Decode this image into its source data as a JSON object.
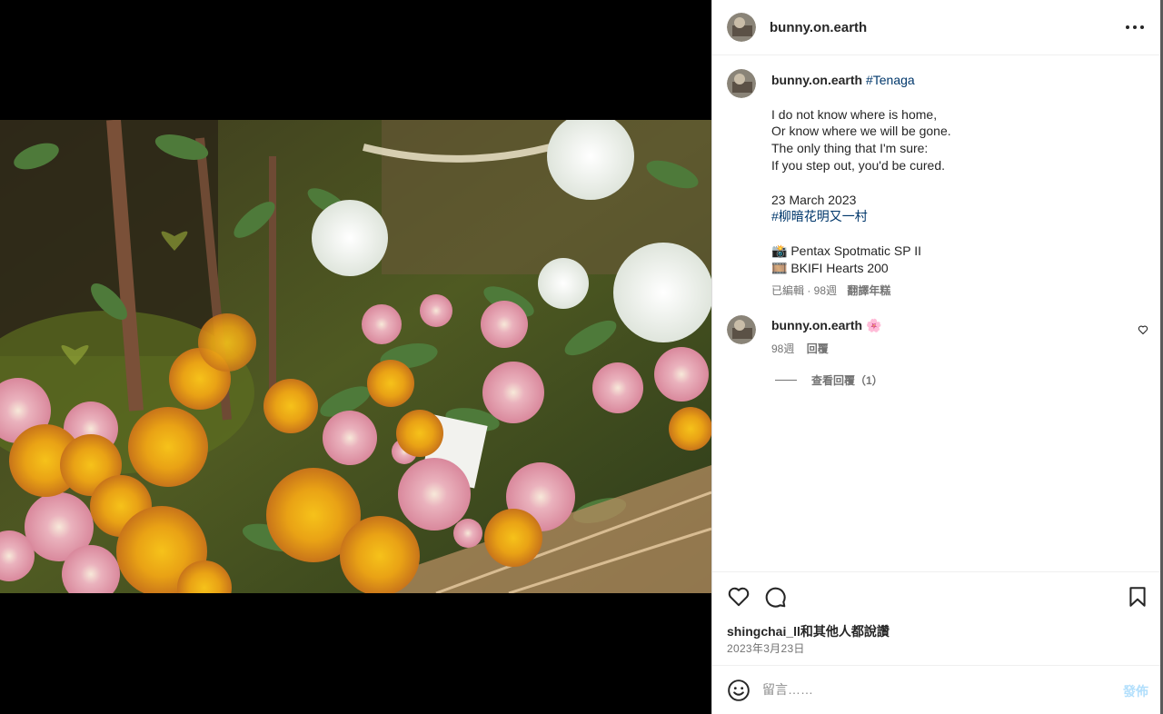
{
  "post": {
    "author": "bunny.on.earth",
    "more_icon": "more-horizontal-icon"
  },
  "caption": {
    "username": "bunny.on.earth",
    "hashtag_1": "#Tenaga",
    "lines": [
      "I do not know where is home,",
      "Or know where we will be gone.",
      "The only thing that I'm sure:",
      "If you step out, you'd be cured."
    ],
    "date_text": "23 March 2023",
    "hashtag_2": "#柳暗花明又一村",
    "camera": "📸 Pentax Spotmatic SP II",
    "film": "🎞️ BKIFI Hearts 200",
    "meta": "已編輯 · 98週",
    "translate": "翻譯年糕"
  },
  "comment": {
    "username": "bunny.on.earth",
    "text": "🌸",
    "time": "98週",
    "reply": "回覆",
    "view_replies": "查看回覆（1）"
  },
  "actions": {
    "likes_text": "shingchai_ll和其他人都說讚",
    "date": "2023年3月23日"
  },
  "composer": {
    "placeholder": "留言……",
    "post_label": "發佈"
  },
  "colors": {
    "hashtag": "#00376b",
    "muted": "#737373",
    "post_disabled": "#b2dffc"
  }
}
